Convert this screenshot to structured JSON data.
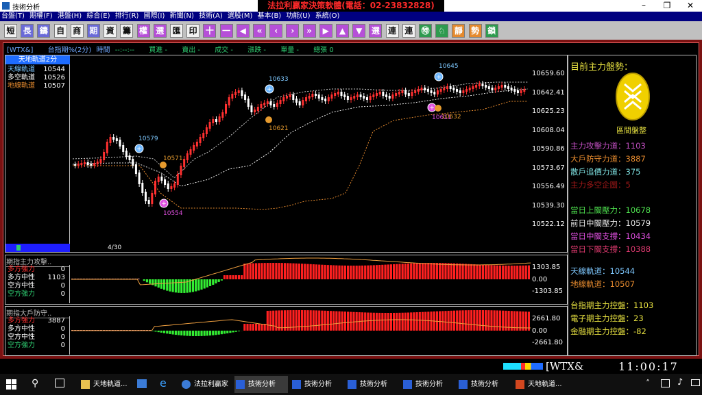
{
  "window": {
    "title": "技術分析",
    "banner": "法拉利贏家決策軟體(電話：02-23832828)"
  },
  "menu": [
    "台盤(T)",
    "期權(F)",
    "港盤(H)",
    "綜合(E)",
    "排行(R)",
    "國際(I)",
    "新聞(N)",
    "技術(A)",
    "選股(M)",
    "基本(B)",
    "功能(U)",
    "系統(O)"
  ],
  "toolbar": {
    "buttons": [
      "短",
      "長",
      "鑄",
      "自",
      "商",
      "期",
      "資",
      "籌",
      "權",
      "選",
      "匯",
      "印",
      "十",
      "一",
      "◀",
      "«",
      "‹",
      "›",
      "»",
      "▶",
      "▲",
      "▼",
      "選",
      "連",
      "連",
      "㊕",
      "♘",
      "靜",
      "勢",
      "鎖"
    ]
  },
  "infobar": {
    "symbol": "[WTX&]",
    "name": "台指期%(2分)",
    "time_label": "時間",
    "time": "--:--:--",
    "buy": "買進 -",
    "sell": "賣出 -",
    "deal": "成交 -",
    "change": "漲跌 -",
    "volume": "單量 -",
    "total": "總張 0"
  },
  "main_panel": {
    "header": "天地軌道2分",
    "rows": [
      {
        "label": "天線軌道",
        "value": "10544"
      },
      {
        "label": "多空軌道",
        "value": "10526"
      },
      {
        "label": "地線軌道",
        "value": "10507"
      }
    ],
    "page": "4/30",
    "y_ticks": [
      "10659.60",
      "10642.41",
      "10625.23",
      "10608.04",
      "10590.86",
      "10573.67",
      "10556.49",
      "10539.30",
      "10522.12"
    ],
    "annotations": [
      "10645",
      "10633",
      "10579",
      "10571",
      "10621",
      "10554",
      "10611",
      "10632"
    ]
  },
  "panel2": {
    "header": "期指主力攻擊..",
    "rows": [
      {
        "label": "多方強力",
        "value": "0"
      },
      {
        "label": "多方中性",
        "value": "1103"
      },
      {
        "label": "空方中性",
        "value": "0"
      },
      {
        "label": "空方強力",
        "value": "0"
      }
    ],
    "y_ticks": [
      "1303.85",
      "0.00",
      "-1303.85"
    ]
  },
  "panel3": {
    "header": "期指大戶防守..",
    "rows": [
      {
        "label": "多方強力",
        "value": "3887"
      },
      {
        "label": "多方中性",
        "value": "0"
      },
      {
        "label": "空方中性",
        "value": "0"
      },
      {
        "label": "空方強力",
        "value": "0"
      }
    ],
    "y_ticks": [
      "2661.80",
      "0.00",
      "-2661.80"
    ]
  },
  "right_panel": {
    "title": "目前主力盤勢：",
    "badge": "區間盤整",
    "lines": [
      {
        "text": "主力攻擊力道：1103",
        "color": "#c04ec0"
      },
      {
        "text": "大戶防守力道：3887",
        "color": "#e58a2e"
      },
      {
        "text": "散戶追價力道：375",
        "color": "#7ee0e0"
      },
      {
        "text": "主力多空企圖：5",
        "color": "#a01818"
      },
      {
        "text": "當日上關壓力：10678",
        "color": "#4ee04e"
      },
      {
        "text": "前日中關壓力：10579",
        "color": "#e6e6e6"
      },
      {
        "text": "當日中關支撐：10434",
        "color": "#e050e0"
      },
      {
        "text": "當日下關支撐：10388",
        "color": "#e03a70"
      },
      {
        "text": "天線軌道：10544",
        "color": "#7ec8ff"
      },
      {
        "text": "地線軌道：10507",
        "color": "#e58a2e"
      },
      {
        "text": "台指期主力控盤：1103",
        "color": "#e6e040"
      },
      {
        "text": "電子期主力控盤：23",
        "color": "#e6e040"
      },
      {
        "text": "金融期主力控盤：-82",
        "color": "#e6e040"
      }
    ]
  },
  "status": {
    "symbol": "[WTX&",
    "clock": "11:00:17"
  },
  "taskbar": [
    "天地軌道...",
    "法拉利贏家",
    "技術分析",
    "技術分析",
    "技術分析",
    "技術分析",
    "技術分析",
    "天地軌道..."
  ]
}
